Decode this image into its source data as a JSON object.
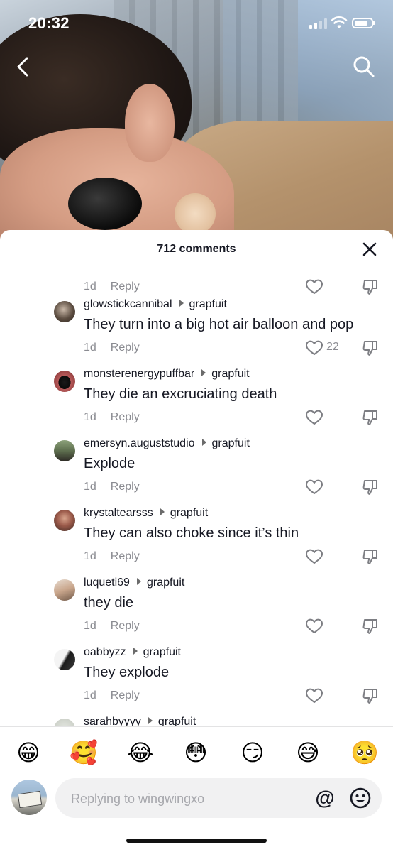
{
  "status_bar": {
    "time": "20:32"
  },
  "sheet": {
    "comments_count": "712 comments",
    "reply_label": "Reply"
  },
  "comments": [
    {
      "username": "",
      "reply_to": "",
      "text": "",
      "age": "1d",
      "likes": ""
    },
    {
      "username": "glowstickcannibal",
      "reply_to": "grapfuit",
      "text": "They turn into a big hot air balloon and pop",
      "age": "1d",
      "likes": "22"
    },
    {
      "username": "monsterenergypuffbar",
      "reply_to": "grapfuit",
      "text": "They die an excruciating death",
      "age": "1d",
      "likes": ""
    },
    {
      "username": "emersyn.auguststudio",
      "reply_to": "grapfuit",
      "text": "Explode",
      "age": "1d",
      "likes": ""
    },
    {
      "username": "krystaltearsss",
      "reply_to": "grapfuit",
      "text": "They can also choke since it’s thin",
      "age": "1d",
      "likes": ""
    },
    {
      "username": "luqueti69",
      "reply_to": "grapfuit",
      "text": "they die",
      "age": "1d",
      "likes": ""
    },
    {
      "username": "oabbyzz",
      "reply_to": "grapfuit",
      "text": "They explode",
      "age": "1d",
      "likes": ""
    },
    {
      "username": "sarahbyyyy",
      "reply_to": "grapfuit",
      "text": "",
      "age": "",
      "likes": ""
    }
  ],
  "emojis": [
    "😁",
    "🥰",
    "😂",
    "😳",
    "😏",
    "😅",
    "🥺"
  ],
  "composer": {
    "placeholder": "Replying to wingwingxo",
    "mention_symbol": "@"
  },
  "colors": {
    "text": "#161823",
    "secondary": "#8a8b91",
    "input_bg": "#f1f1f2"
  }
}
